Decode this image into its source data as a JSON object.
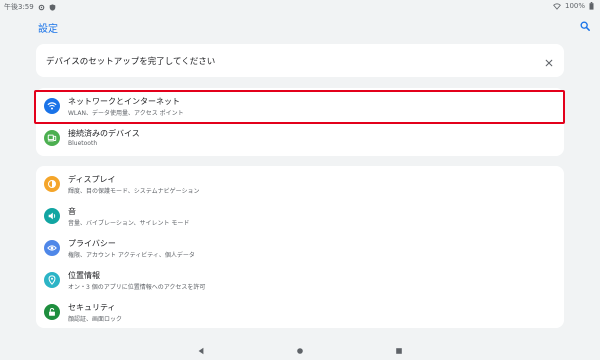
{
  "status_bar": {
    "time": "午後3:59",
    "battery": "100%",
    "icons": [
      "gear-icon",
      "shield-icon",
      "wifi-icon",
      "battery-icon"
    ]
  },
  "app_bar": {
    "title": "設定",
    "search_icon": "search-icon"
  },
  "setup_card": {
    "text": "デバイスのセットアップを完了してください",
    "close_icon": "close-icon"
  },
  "settings": {
    "group1": [
      {
        "title": "ネットワークとインターネット",
        "summary": "WLAN、データ使用量、アクセス ポイント",
        "icon": "wifi-icon",
        "color": "#1a73e8",
        "highlighted": true
      },
      {
        "title": "接続済みのデバイス",
        "summary": "Bluetooth",
        "icon": "devices-icon",
        "color": "#4caf50"
      }
    ],
    "group2": [
      {
        "title": "ディスプレイ",
        "summary": "輝度、目の保護モード、システムナビゲーション",
        "icon": "brightness-icon",
        "color": "#f4a52a"
      },
      {
        "title": "音",
        "summary": "音量、バイブレーション、サイレント モード",
        "icon": "volume-icon",
        "color": "#12a5a2"
      },
      {
        "title": "プライバシー",
        "summary": "権限、アカウント アクティビティ、個人データ",
        "icon": "eye-icon",
        "color": "#4f87e8"
      },
      {
        "title": "位置情報",
        "summary": "オン・3 個のアプリに位置情報へのアクセスを許可",
        "icon": "location-icon",
        "color": "#2cb4c6"
      },
      {
        "title": "セキュリティ",
        "summary": "顔認証、画面ロック",
        "icon": "lock-icon",
        "color": "#1e8e3e"
      }
    ]
  },
  "colors": {
    "accent": "#1a73e8",
    "highlight_border": "#e3001b",
    "background": "#f1f3f4"
  },
  "nav_bar": {
    "icons": [
      "back-icon",
      "home-icon",
      "recents-icon"
    ]
  }
}
